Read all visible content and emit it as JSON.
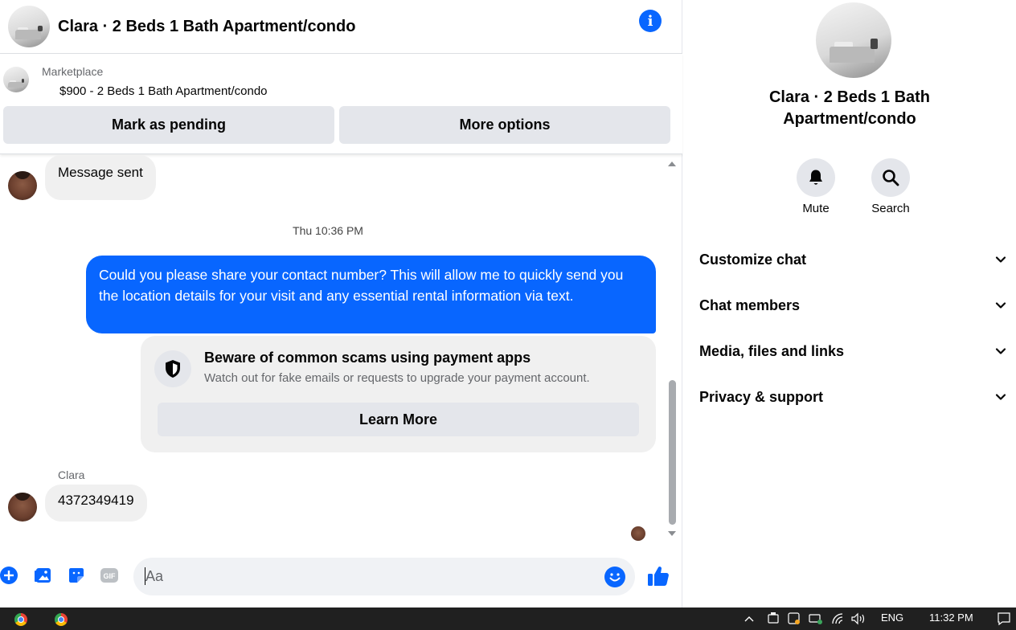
{
  "header": {
    "title": "Clara · 2 Beds 1 Bath Apartment/condo",
    "info_glyph": "i"
  },
  "marketplace": {
    "label": "Marketplace",
    "listing": "$900 - 2 Beds 1 Bath Apartment/condo",
    "mark_pending_label": "Mark as pending",
    "more_options_label": "More options"
  },
  "messages": {
    "first_incoming": "Message sent",
    "timestamp": "Thu 10:36 PM",
    "outgoing": "Could you please share your contact number? This will allow me to quickly send you the location details for your visit and any essential rental information via text.",
    "scam_title": "Beware of common scams using payment apps",
    "scam_desc": "Watch out for fake emails or requests to upgrade your payment account.",
    "learn_more_label": "Learn More",
    "sender_name": "Clara",
    "reply": "4372349419"
  },
  "composer": {
    "placeholder": "Aa",
    "gif_label": "GIF"
  },
  "panel": {
    "title_line1": "Clara · 2 Beds 1 Bath",
    "title_line2": "Apartment/condo",
    "mute_label": "Mute",
    "search_label": "Search",
    "sections": [
      "Customize chat",
      "Chat members",
      "Media, files and links",
      "Privacy & support"
    ]
  },
  "taskbar": {
    "language": "ENG",
    "time": "11:32 PM"
  },
  "colors": {
    "accent": "#0866ff",
    "bubble_in": "#f0f0f0",
    "button_bg": "#e4e6eb"
  }
}
